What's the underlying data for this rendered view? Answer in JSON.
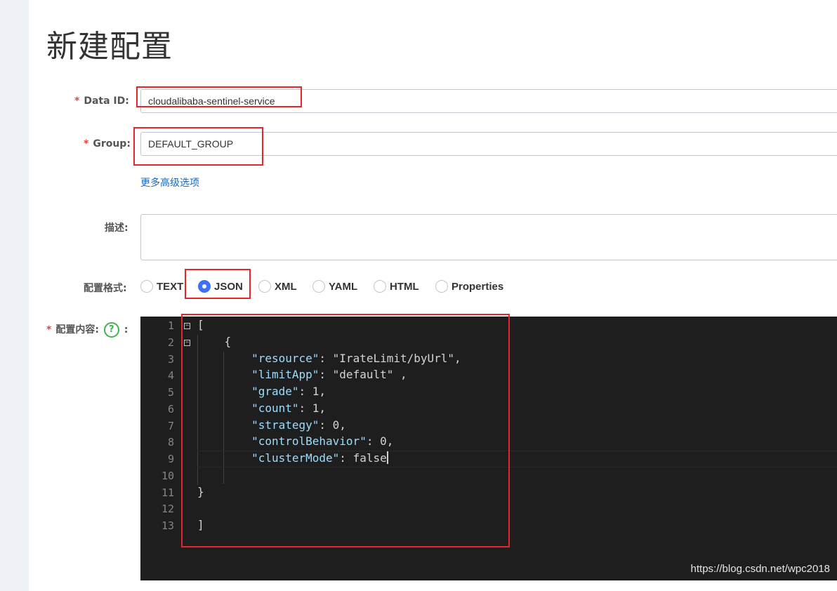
{
  "page": {
    "title": "新建配置"
  },
  "form": {
    "data_id": {
      "label": "Data ID:",
      "value": "cloudalibaba-sentinel-service"
    },
    "group": {
      "label": "Group:",
      "value": "DEFAULT_GROUP"
    },
    "more_options_link": "更多高级选项",
    "description": {
      "label": "描述:",
      "value": ""
    },
    "format": {
      "label": "配置格式:",
      "options": [
        "TEXT",
        "JSON",
        "XML",
        "YAML",
        "HTML",
        "Properties"
      ],
      "selected": "JSON"
    },
    "content": {
      "label": "配置内容:",
      "help_icon": "question-circle-icon",
      "colon": ":"
    },
    "required_mark": "*"
  },
  "editor": {
    "line_numbers": [
      "1",
      "2",
      "3",
      "4",
      "5",
      "6",
      "7",
      "8",
      "9",
      "10",
      "11",
      "12",
      "13"
    ],
    "lines": [
      "[",
      "    {",
      "        \"resource\": \"IrateLimit/byUrl\",",
      "        \"limitApp\": \"default\" ,",
      "        \"grade\": 1,",
      "        \"count\": 1,",
      "        \"strategy\": 0,",
      "        \"controlBehavior\": 0,",
      "        \"clusterMode\": false",
      "",
      "}",
      "",
      "]"
    ]
  },
  "watermark": "https://blog.csdn.net/wpc2018",
  "colors": {
    "required": "#e64340",
    "link": "#2069b8",
    "radio_checked": "#3e71f7",
    "help_icon": "#3eb54a",
    "highlight_box": "#e5262d",
    "editor_bg": "#1e1e1e"
  }
}
